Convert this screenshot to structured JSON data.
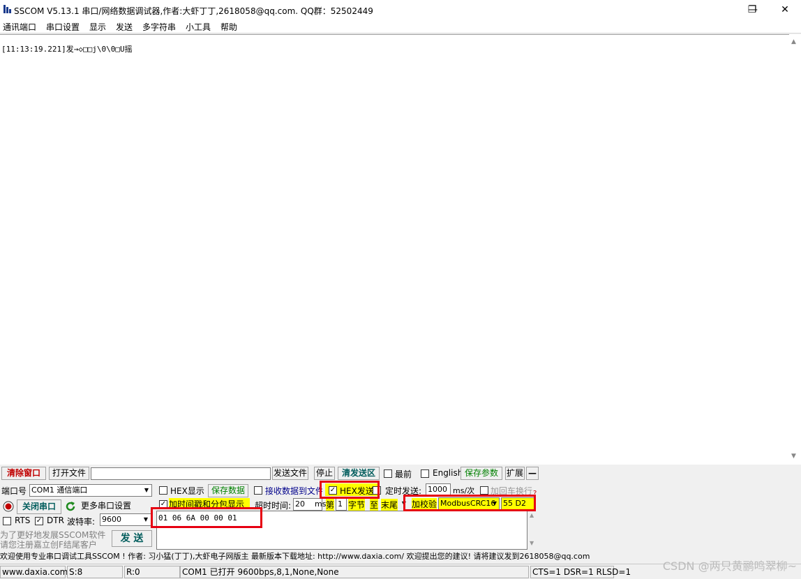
{
  "window": {
    "title": "SSCOM V5.13.1 串口/网络数据调试器,作者:大虾丁丁,2618058@qq.com. QQ群：52502449",
    "minimize": "—",
    "maximize": "❐",
    "close": "✕"
  },
  "menu": [
    "通讯端口",
    "串口设置",
    "显示",
    "发送",
    "多字符串",
    "小工具",
    "帮助"
  ],
  "receive": {
    "lines": [
      "[11:13:19.221]发→◇□□j\\0\\0□U摇"
    ]
  },
  "toolbar": {
    "clear_window": "清除窗口",
    "open_file": "打开文件",
    "file_path": "",
    "send_file": "发送文件",
    "stop": "停止",
    "clear_send": "清发送区",
    "topmost": "最前",
    "english": "English",
    "save_params": "保存参数",
    "expand": "扩展",
    "collapse": "—"
  },
  "port": {
    "label": "端口号",
    "value": "COM1 通信端口",
    "close_port": "关闭串口",
    "more_settings": "更多串口设置",
    "rts": "RTS",
    "rts_checked": false,
    "dtr": "DTR",
    "dtr_checked": true,
    "baud_label": "波特率:",
    "baud": "9600",
    "promo1": "为了更好地发展SSCOM软件",
    "promo2": "请您注册嘉立创F结尾客户"
  },
  "options": {
    "hex_display": "HEX显示",
    "save_data": "保存数据",
    "recv_to_file": "接收数据到文件",
    "hex_send": "HEX发送",
    "hex_send_checked": true,
    "timed_send": "定时发送:",
    "timed_value": "1000",
    "timed_unit": "ms/次",
    "add_newline": "加回车换行",
    "timestamp": "加时间戳和分包显示",
    "timestamp_checked": true,
    "timeout_label": "超时时间:",
    "timeout_value": "20",
    "timeout_unit": "ms",
    "byte_from_label": "第",
    "byte_from": "1",
    "byte_unit": "字节",
    "to_label": "至",
    "to_value": "末尾",
    "checksum_label": "加校验",
    "checksum_type": "ModbusCRC16",
    "checksum_value": "55 D2",
    "help_mark": "?"
  },
  "send": {
    "data": "01 06 6A 00 00 01",
    "button": "发  送"
  },
  "footer": {
    "text": "欢迎使用专业串口调试工具SSCOM !  作者: 习小猛(丁丁),大虾电子网版主  最新版本下载地址: http://www.daxia.com/ 欢迎提出您的建议! 请将建议发到2618058@qq.com"
  },
  "status": {
    "site": "www.daxia.com",
    "sent": "S:8",
    "recv": "R:0",
    "port_state": "COM1 已打开  9600bps,8,1,None,None",
    "signals": "CTS=1 DSR=1 RLSD=1"
  },
  "watermark": "CSDN @两只黄鹂鸣翠柳~"
}
